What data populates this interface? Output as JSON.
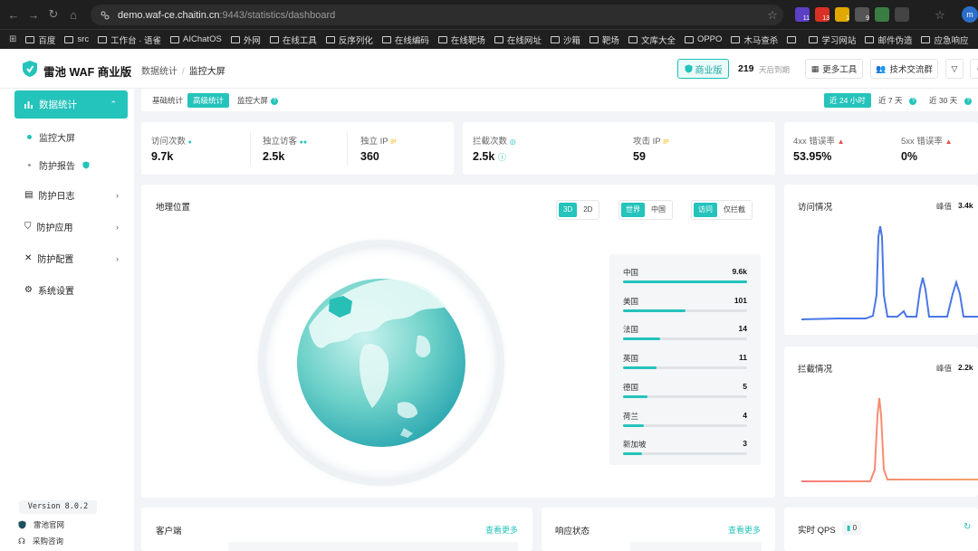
{
  "browser": {
    "url_host": "demo.waf-ce.chaitin.cn",
    "url_path": ":9443/statistics/dashboard",
    "extensions": [
      {
        "badge": "11",
        "color": "#5b3fc4"
      },
      {
        "badge": "13",
        "color": "#d93025"
      },
      {
        "badge": "1",
        "color": "#e0a800"
      },
      {
        "badge": "9",
        "color": "#555"
      },
      {
        "badge": "",
        "color": "#3a7d44"
      },
      {
        "badge": "",
        "color": "#444"
      }
    ],
    "profile_initial": "m",
    "bookmarks": [
      "百度",
      "src",
      "工作台 · 语雀",
      "AIChatOS",
      "外网",
      "在线工具",
      "反序列化",
      "在线编码",
      "在线靶场",
      "在线网址",
      "沙箱",
      "靶场",
      "文库大全",
      "OPPO",
      "木马查杀",
      "",
      "学习网站",
      "邮件伪造",
      "应急响应"
    ]
  },
  "header": {
    "brand": "雷池 WAF 商业版",
    "breadcrumb": [
      "数据统计",
      "监控大屏"
    ],
    "edition_label": "商业版",
    "days_value": "219",
    "days_label": "天后到期",
    "more_tools": "更多工具",
    "community": "技术交流群"
  },
  "sidebar": {
    "active": "数据统计",
    "sub_items": [
      "监控大屏",
      "防护报告"
    ],
    "items": [
      "防护日志",
      "防护应用",
      "防护配置",
      "系统设置"
    ],
    "version": "Version 8.0.2",
    "links": [
      "雷池官网",
      "采购咨询"
    ]
  },
  "filters": {
    "tabs": [
      "基础统计",
      "高级统计",
      "监控大屏"
    ],
    "ranges": [
      "近 24 小时",
      "近 7 天",
      "近 30 天"
    ]
  },
  "stats": {
    "visits": {
      "label": "访问次数",
      "value": "9.7k"
    },
    "unique_visitors": {
      "label": "独立访客",
      "value": "2.5k"
    },
    "unique_ip": {
      "label": "独立 IP",
      "value": "360"
    },
    "blocked": {
      "label": "拦截次数",
      "value": "2.5k"
    },
    "attack_ip": {
      "label": "攻击 IP",
      "value": "59"
    },
    "err4xx": {
      "label": "4xx 错误率",
      "value": "53.95%"
    },
    "err5xx": {
      "label": "5xx 错误率",
      "value": "0%"
    }
  },
  "geo": {
    "title": "地理位置",
    "view_toggle": [
      "3D",
      "2D"
    ],
    "scope_toggle": [
      "世界",
      "中国"
    ],
    "type_toggle": [
      "访问",
      "仅拦截"
    ],
    "ranking": [
      {
        "name": "中国",
        "value": "9.6k",
        "fraction": 1.0
      },
      {
        "name": "美国",
        "value": "101",
        "fraction": 0.5
      },
      {
        "name": "法国",
        "value": "14",
        "fraction": 0.3
      },
      {
        "name": "英国",
        "value": "11",
        "fraction": 0.27
      },
      {
        "name": "德国",
        "value": "5",
        "fraction": 0.2
      },
      {
        "name": "荷兰",
        "value": "4",
        "fraction": 0.17
      },
      {
        "name": "新加坡",
        "value": "3",
        "fraction": 0.15
      }
    ]
  },
  "access_chart": {
    "title": "访问情况",
    "peak_label": "峰值",
    "peak_value": "3.4k",
    "color": "#4a76e8"
  },
  "block_chart": {
    "title": "拦截情况",
    "peak_label": "峰值",
    "peak_value": "2.2k",
    "color": "#f07b74"
  },
  "bottom": {
    "client": {
      "title": "客户端",
      "more": "查看更多"
    },
    "response": {
      "title": "响应状态",
      "more": "查看更多"
    },
    "qps": {
      "title": "实时 QPS",
      "value": "0"
    }
  },
  "colors": {
    "accent": "#24c3bb",
    "warn": "#f5b400",
    "danger": "#e34d4d"
  }
}
